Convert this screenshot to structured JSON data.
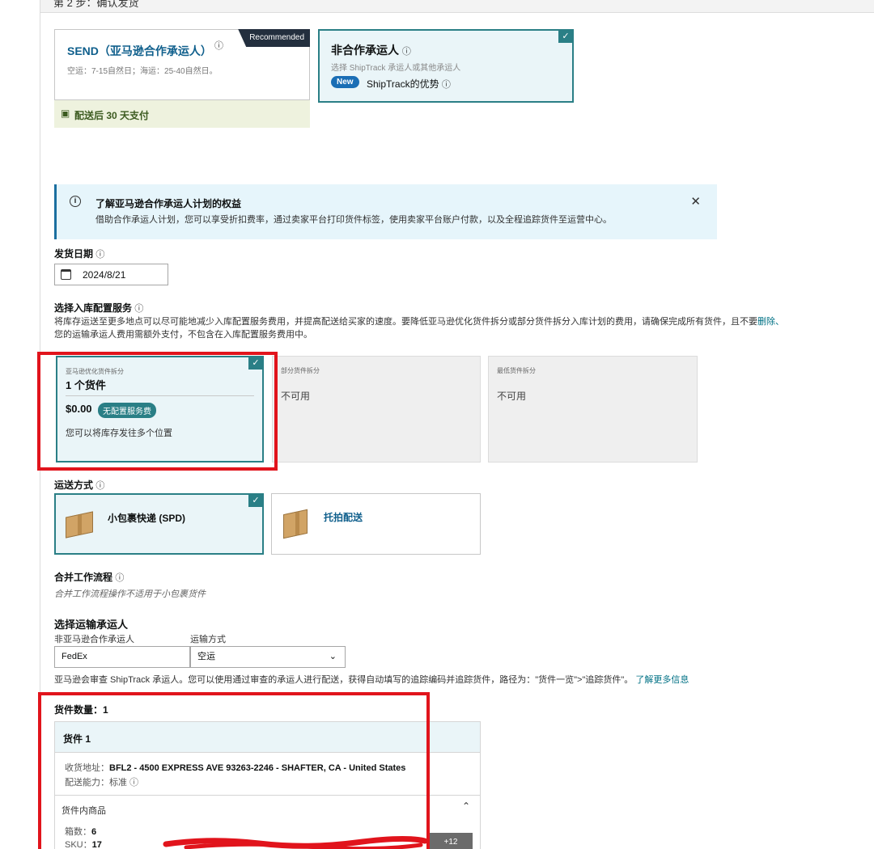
{
  "header": {
    "step_title": "第 2 步：确认发货"
  },
  "carrier_programs": {
    "send": {
      "title": "SEND（亚马逊合作承运人）",
      "subtitle": "空运：7-15自然日；海运：25-40自然日。",
      "badge": "Recommended",
      "pay_note": "配送后 30 天支付"
    },
    "non_partner": {
      "title": "非合作承运人",
      "subtitle": "选择 ShipTrack 承运人或其他承运人",
      "new_badge": "New",
      "advantage": "ShipTrack的优势"
    }
  },
  "banner": {
    "title": "了解亚马逊合作承运人计划的权益",
    "description": "借助合作承运人计划，您可以享受折扣费率，通过卖家平台打印货件标签，使用卖家平台账户付款，以及全程追踪货件至运营中心。"
  },
  "ship_date": {
    "label": "发货日期",
    "value": "2024/8/21"
  },
  "placement": {
    "label": "选择入库配置服务",
    "description_line1": "将库存运送至更多地点可以尽可能地减少入库配置服务费用，并提高配送给买家的速度。要降低亚马逊优化货件拆分或部分货件拆分入库计划的费用，请确保完成所有货件，且不要",
    "description_link": "删除、",
    "description_line2": "您的运输承运人费用需额外支付，不包含在入库配置服务费用中。",
    "options": [
      {
        "small": "亚马逊优化货件拆分",
        "count": "1 个货件",
        "price": "$0.00",
        "fee_badge": "无配置服务费",
        "desc": "您可以将库存发往多个位置"
      },
      {
        "small": "部分货件拆分",
        "status": "不可用"
      },
      {
        "small": "最低货件拆分",
        "status": "不可用"
      }
    ]
  },
  "shipping_mode": {
    "label": "运送方式",
    "options": [
      {
        "label": "小包裹快递 (SPD)"
      },
      {
        "label": "托拍配送"
      }
    ]
  },
  "workflow": {
    "label": "合并工作流程",
    "note": "合并工作流程操作不适用于小包裹货件"
  },
  "carrier": {
    "label": "选择运输承运人",
    "carrier_label": "非亚马逊合作承运人",
    "carrier_value": "FedEx",
    "mode_label": "运输方式",
    "mode_value": "空运",
    "note": "亚马逊会审查 ShipTrack 承运人。您可以使用通过审查的承运人进行配送，获得自动填写的追踪编码并追踪货件，路径为：\"货件一览\">\"追踪货件\"。",
    "learn_more": "了解更多信息"
  },
  "shipments": {
    "count_label": "货件数量：1",
    "shipment_title": "货件 1",
    "address_label": "收货地址：",
    "address_value": "BFL2 - 4500 EXPRESS AVE 93263-2246 - SHAFTER, CA - United States",
    "capability_label": "配送能力：",
    "capability_value": "标准",
    "items_label": "货件内商品",
    "boxes_label": "箱数：",
    "boxes_value": "6",
    "sku_label": "SKU：",
    "sku_value": "17",
    "more_chip": "+12"
  },
  "colors": {
    "accent": "#2a7f86",
    "link": "#007185",
    "highlight": "#e1141c"
  }
}
